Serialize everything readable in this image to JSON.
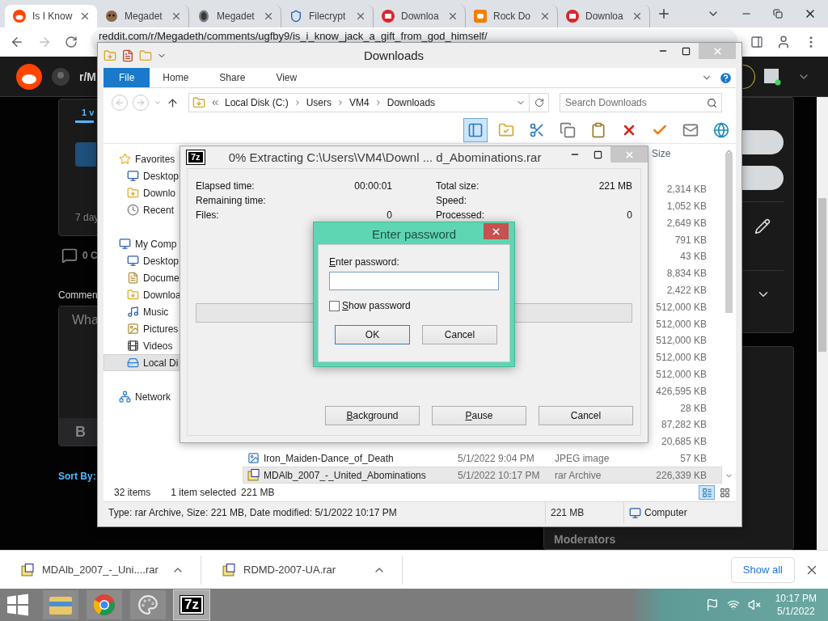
{
  "browser": {
    "tabs": [
      {
        "title": "Is I Know",
        "selected": true,
        "kind": "reddit"
      },
      {
        "title": "Megadet",
        "selected": false,
        "kind": "skull"
      },
      {
        "title": "Megadet",
        "selected": false,
        "kind": "mask"
      },
      {
        "title": "Filecrypt",
        "selected": false,
        "kind": "shield"
      },
      {
        "title": "Downloa",
        "selected": false,
        "kind": "mega"
      },
      {
        "title": "Rock Do",
        "selected": false,
        "kind": "blogger"
      },
      {
        "title": "Downloa",
        "selected": false,
        "kind": "mega"
      }
    ],
    "url": "reddit.com/r/Megadeth/comments/ugfby9/is_i_know_jack_a_gift_from_god_himself/"
  },
  "reddit": {
    "subreddit": "r/M",
    "post_tab": "1 v",
    "post_age": "7 day",
    "comment_count": "0 C",
    "comment_heading": "Commen",
    "comment_box": {
      "placeholder": "Wha"
    },
    "bold_button": "B",
    "sort_label": "Sort By:",
    "sidebar_heading": "Moderators"
  },
  "explorer": {
    "title": "Downloads",
    "ribbon_tabs": [
      {
        "label": "File",
        "selected": true
      },
      {
        "label": "Home",
        "selected": false
      },
      {
        "label": "Share",
        "selected": false
      },
      {
        "label": "View",
        "selected": false
      }
    ],
    "breadcrumb": [
      "Local Disk (C:)",
      "Users",
      "VM4",
      "Downloads"
    ],
    "search": {
      "placeholder": "Search Downloads"
    },
    "toolbar": [
      {
        "kind": "pane",
        "selected": true
      },
      {
        "kind": "folder",
        "selected": false
      },
      {
        "kind": "cut",
        "selected": false
      },
      {
        "kind": "copy",
        "selected": false
      },
      {
        "kind": "paste",
        "selected": false
      },
      {
        "kind": "delete",
        "selected": false
      },
      {
        "kind": "check",
        "selected": false
      },
      {
        "kind": "properties",
        "selected": false
      },
      {
        "kind": "globe",
        "selected": false
      }
    ],
    "nav": [
      {
        "label": "Favorites",
        "kind": "star",
        "selected": false,
        "children": [
          {
            "label": "Desktop",
            "kind": "desktop",
            "selected": false
          },
          {
            "label": "Downlo",
            "kind": "downloads",
            "selected": false
          },
          {
            "label": "Recent",
            "kind": "recent",
            "selected": false
          }
        ]
      },
      {
        "label": "My Comp",
        "kind": "computer",
        "selected": false,
        "children": [
          {
            "label": "Desktop",
            "kind": "desktop",
            "selected": false
          },
          {
            "label": "Docume",
            "kind": "documents",
            "selected": false
          },
          {
            "label": "Downloa",
            "kind": "downloads",
            "selected": false
          },
          {
            "label": "Music",
            "kind": "music",
            "selected": false
          },
          {
            "label": "Pictures",
            "kind": "pictures",
            "selected": false
          },
          {
            "label": "Videos",
            "kind": "videos",
            "selected": false
          },
          {
            "label": "Local Di",
            "kind": "disk",
            "selected": true
          }
        ]
      },
      {
        "label": "Network",
        "kind": "network",
        "selected": false
      }
    ],
    "size_column": "Size",
    "files": [
      {
        "size": "2,314 KB",
        "selected": false
      },
      {
        "size": "1,052 KB",
        "selected": false
      },
      {
        "size": "2,649 KB",
        "selected": false
      },
      {
        "size": "791 KB",
        "selected": false
      },
      {
        "size": "43 KB",
        "selected": false
      },
      {
        "size": "8,834 KB",
        "selected": false
      },
      {
        "size": "2,422 KB",
        "selected": false
      },
      {
        "size": "512,000 KB",
        "selected": false
      },
      {
        "size": "512,000 KB",
        "selected": false
      },
      {
        "size": "512,000 KB",
        "selected": false
      },
      {
        "size": "512,000 KB",
        "selected": false
      },
      {
        "size": "512,000 KB",
        "selected": false
      },
      {
        "size": "426,595 KB",
        "selected": false
      },
      {
        "size": "28 KB",
        "selected": false
      },
      {
        "size": "87,282 KB",
        "selected": false
      },
      {
        "size": "20,685 KB",
        "selected": false
      },
      {
        "name": "Iron_Maiden-Dance_of_Death",
        "date": "5/1/2022 9:04 PM",
        "type": "JPEG image",
        "size": "57 KB",
        "kind": "image",
        "selected": false
      },
      {
        "name": "MDAlb_2007_-_United_Abominations",
        "date": "5/1/2022 10:17 PM",
        "type": "rar Archive",
        "size": "226,339 KB",
        "kind": "archive",
        "selected": true
      }
    ],
    "status": {
      "count": "32 items",
      "selection": "1 item selected",
      "selection_size": "221 MB"
    },
    "views": [
      {
        "kind": "details",
        "selected": true
      },
      {
        "kind": "tiles",
        "selected": false
      }
    ],
    "details": {
      "text": "Type: rar Archive, Size: 221 MB, Date modified: 5/1/2022 10:17 PM",
      "size": "221 MB",
      "location": "Computer"
    }
  },
  "extract_dialog": {
    "logo": "7z",
    "title": "0% Extracting C:\\Users\\VM4\\Downl ... d_Abominations.rar",
    "stats": [
      {
        "label": "Elapsed time:",
        "value": "00:00:01"
      },
      {
        "label": "Total size:",
        "value": "221 MB"
      },
      {
        "label": "Remaining time:"
      },
      {
        "label": "Speed:"
      },
      {
        "label": "Files:",
        "value": "0"
      },
      {
        "label": "Processed:",
        "value": "0"
      }
    ],
    "progress": {
      "level": 0
    },
    "buttons": [
      "Background",
      "Pause",
      "Cancel"
    ]
  },
  "password_dialog": {
    "title": "Enter password",
    "field_label": "Enter password:",
    "show_password": {
      "label": "Show password",
      "checked": false
    },
    "buttons": [
      {
        "label": "OK",
        "focused": true
      },
      {
        "label": "Cancel",
        "focused": false
      }
    ]
  },
  "downloads_bar": {
    "items": [
      {
        "name": "MDAlb_2007_-_Uni....rar"
      },
      {
        "name": "RDMD-2007-UA.rar"
      }
    ],
    "show_all": "Show all"
  },
  "taskbar": {
    "apps": [
      {
        "kind": "explorer",
        "selected": false
      },
      {
        "kind": "chrome",
        "selected": false
      },
      {
        "kind": "paint",
        "selected": false
      },
      {
        "kind": "sevenzip",
        "label": "7z",
        "selected": true
      }
    ],
    "time": "10:17 PM",
    "date": "5/1/2022"
  }
}
